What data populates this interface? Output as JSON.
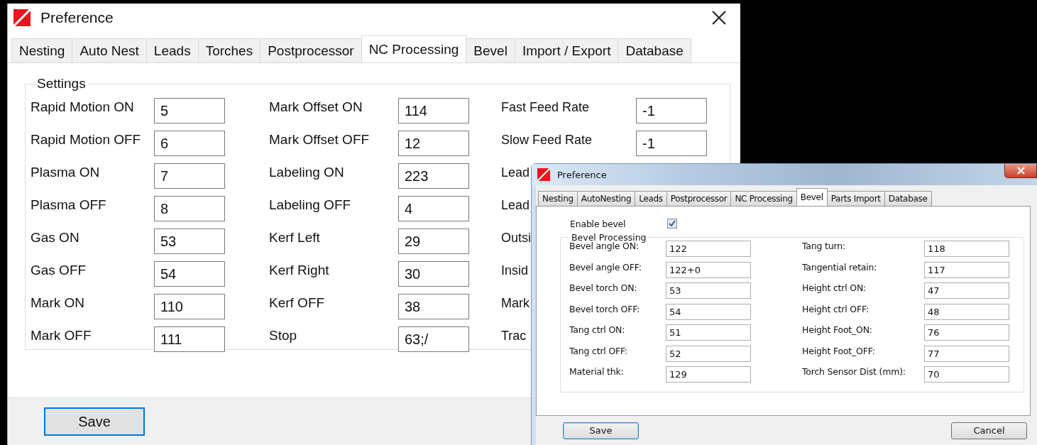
{
  "main_window": {
    "title": "Preference",
    "tabs": [
      {
        "label": "Nesting",
        "selected": false
      },
      {
        "label": "Auto Nest",
        "selected": false
      },
      {
        "label": "Leads",
        "selected": false
      },
      {
        "label": "Torches",
        "selected": false
      },
      {
        "label": "Postprocessor",
        "selected": false
      },
      {
        "label": "NC Processing",
        "selected": true
      },
      {
        "label": "Bevel",
        "selected": false
      },
      {
        "label": "Import / Export",
        "selected": false
      },
      {
        "label": "Database",
        "selected": false
      }
    ],
    "group_title": "Settings",
    "columns": [
      [
        {
          "label": "Rapid Motion ON",
          "value": "5"
        },
        {
          "label": "Rapid Motion OFF",
          "value": "6"
        },
        {
          "label": "Plasma ON",
          "value": "7"
        },
        {
          "label": "Plasma OFF",
          "value": "8"
        },
        {
          "label": "Gas ON",
          "value": "53"
        },
        {
          "label": "Gas OFF",
          "value": "54"
        },
        {
          "label": "Mark ON",
          "value": "110"
        },
        {
          "label": "Mark OFF",
          "value": "111"
        }
      ],
      [
        {
          "label": "Mark Offset  ON",
          "value": "114"
        },
        {
          "label": "Mark Offset  OFF",
          "value": "12"
        },
        {
          "label": "Labeling ON",
          "value": "223"
        },
        {
          "label": "Labeling OFF",
          "value": "4"
        },
        {
          "label": "Kerf Left",
          "value": "29"
        },
        {
          "label": "Kerf Right",
          "value": "30"
        },
        {
          "label": "Kerf OFF",
          "value": "38"
        },
        {
          "label": "Stop",
          "value": "63;/"
        }
      ],
      [
        {
          "label": "Fast Feed Rate",
          "value": "-1"
        },
        {
          "label": "Slow Feed Rate",
          "value": "-1"
        },
        {
          "label": "Lead"
        },
        {
          "label": "Lead"
        },
        {
          "label": "Outsi"
        },
        {
          "label": "Insid"
        },
        {
          "label": "Mark"
        },
        {
          "label": "Trac"
        }
      ]
    ],
    "buttons": [
      {
        "label": "Save",
        "focused": true
      }
    ]
  },
  "front_window": {
    "title": "Preference",
    "tabs": [
      {
        "label": "Nesting",
        "selected": false
      },
      {
        "label": "AutoNesting",
        "selected": false
      },
      {
        "label": "Leads",
        "selected": false
      },
      {
        "label": "Postprocessor",
        "selected": false
      },
      {
        "label": "NC Processing",
        "selected": false
      },
      {
        "label": "Bevel",
        "selected": true
      },
      {
        "label": "Parts Import",
        "selected": false
      },
      {
        "label": "Database",
        "selected": false
      }
    ],
    "enable_bevel": {
      "label": "Enable bevel",
      "checked": true
    },
    "group_title": "Bevel Processing",
    "columns": [
      [
        {
          "label": "Bevel angle ON:",
          "value": "122"
        },
        {
          "label": "Bevel angle OFF:",
          "value": "122+0"
        },
        {
          "label": "Bevel torch ON:",
          "value": "53"
        },
        {
          "label": "Bevel torch OFF:",
          "value": "54"
        },
        {
          "label": "Tang ctrl ON:",
          "value": "51"
        },
        {
          "label": "Tang ctrl OFF:",
          "value": "52"
        },
        {
          "label": "Material thk:",
          "value": "129"
        }
      ],
      [
        {
          "label": "Tang turn:",
          "value": "118"
        },
        {
          "label": "Tangential retain:",
          "value": "117"
        },
        {
          "label": "Height ctrl ON:",
          "value": "47"
        },
        {
          "label": "Height ctrl OFF:",
          "value": "48"
        },
        {
          "label": "Height Foot_ON:",
          "value": "76"
        },
        {
          "label": "Height Foot_OFF:",
          "value": "77"
        },
        {
          "label": "Torch Sensor Dist (mm):",
          "value": "70"
        }
      ]
    ],
    "buttons": [
      {
        "label": "Save",
        "focused": true
      },
      {
        "label": "Cancel",
        "focused": false
      }
    ]
  }
}
